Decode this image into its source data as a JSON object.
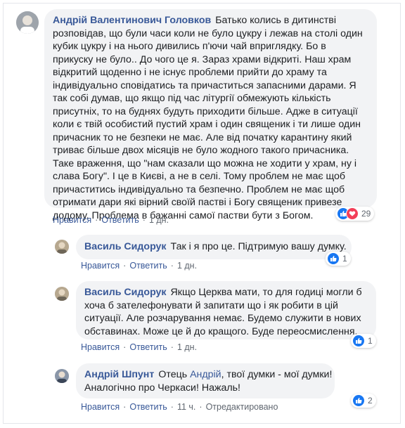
{
  "comments": [
    {
      "author": "Андрій Валентинович Головков",
      "lines": [
        "Батько колись в дитинстві",
        "розповідав, що були часи коли не було цукру і лежав на столі один",
        "кубик цукру і на нього дивились п'ючи чай вприглядку. Бо в",
        "прикуску не було.. До чого це я. Зараз храми відкриті. Наш храм",
        "відкритий щоденно і не існує проблеми прийти до храму та",
        "індивідуально сповідатись та причаститься запасними дарами. Я",
        "так собі думав, що якщо під час літургії обмежують кількість",
        "присутніх, то на буднях будуть приходити більше. Адже в ситуації",
        "коли є твій особистий пустий храм і один священик і ти лише один",
        "причасник то не безпеки не має. Але від початку карантину який",
        "триває більше двох місяців не було жодного такого причасника.",
        "Таке враження, що \"нам сказали що можна не ходити у храм, ну і",
        "слава Богу\". І це в Києві, а не в селі. Тому проблем не має щоб",
        "причаститись індивідуально та безпечно. Проблем не має щоб",
        "отримати дари які вірний своїй пастві і Богу священик привезе",
        "додому. Проблема в бажанні самої пастви бути з Богом."
      ],
      "actions": {
        "like": "Нравится",
        "reply": "Ответить",
        "time": "1 дн."
      },
      "reactions": {
        "count": "29",
        "types": [
          "like",
          "love"
        ]
      }
    },
    {
      "author": "Василь Сидорук",
      "lines": [
        "Так і я про це. Підтримую вашу думку."
      ],
      "actions": {
        "like": "Нравится",
        "reply": "Ответить",
        "time": "1 дн."
      },
      "reactions": {
        "count": "1",
        "types": [
          "like"
        ]
      }
    },
    {
      "author": "Василь Сидорук",
      "lines": [
        "Якщо Церква мати, то для годиці могли б",
        "хоча б зателефонувати й запитати що і як робити в цій",
        "ситуації. Але розчарування немає. Будемо служити в нових",
        "обставинах. Може це й до кращого. Буде переосмислення."
      ],
      "actions": {
        "like": "Нравится",
        "reply": "Ответить",
        "time": "1 дн."
      },
      "reactions": {
        "count": "1",
        "types": [
          "like"
        ]
      }
    },
    {
      "author": "Андрій Шпунт",
      "line1_prefix": "Отець ",
      "mention": "Андрій",
      "line1_suffix": ", твої думки - мої думки!",
      "line2": "Аналогічно про Черкаси! Нажаль!",
      "actions": {
        "like": "Нравится",
        "reply": "Ответить",
        "time": "11 ч.",
        "edited": "Отредактировано"
      },
      "reactions": {
        "count": "2",
        "types": [
          "like"
        ]
      }
    }
  ],
  "colors": {
    "link": "#385898",
    "bubble": "#f2f3f5",
    "like": "#1877f2",
    "love": "#f33e58",
    "meta": "#606770"
  }
}
